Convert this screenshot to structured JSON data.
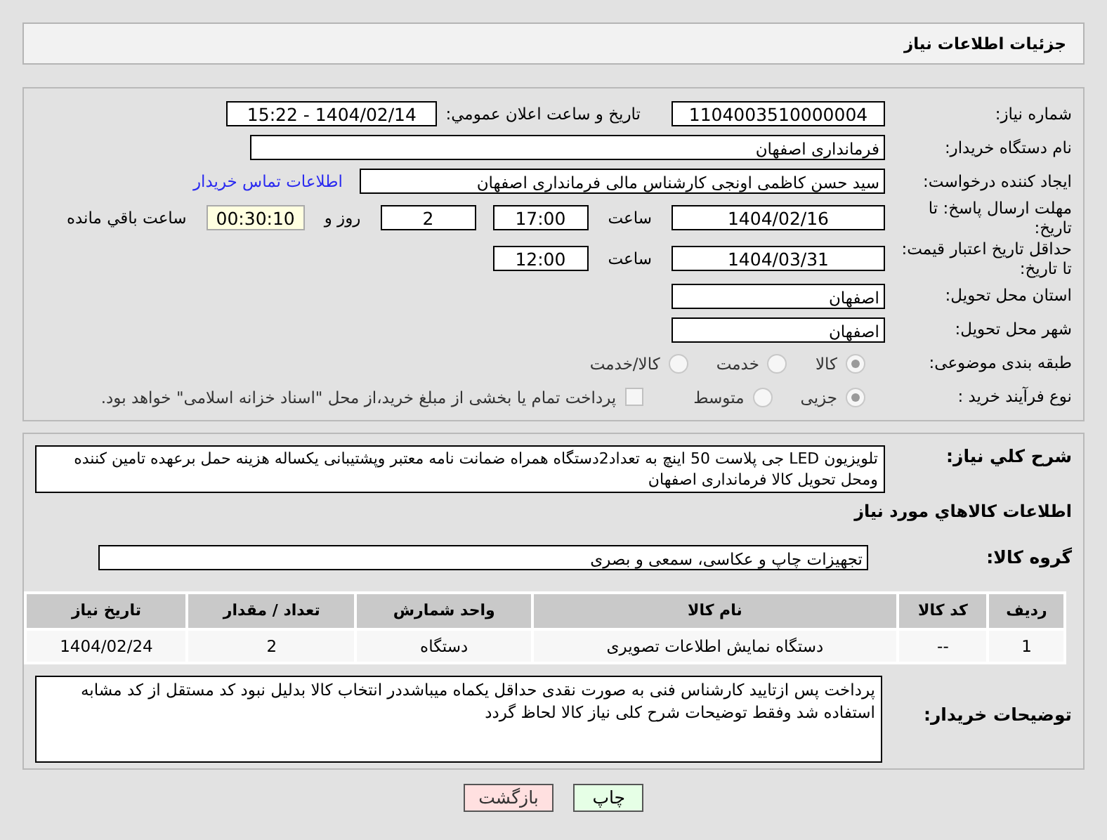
{
  "header": {
    "title": "جزئیات اطلاعات نیاز"
  },
  "need_number": {
    "label": "شماره نیاز:",
    "value": "1104003510000004"
  },
  "announcement": {
    "label": "تاریخ و ساعت اعلان عمومي:",
    "value": "1404/02/14 - 15:22"
  },
  "buyer_org": {
    "label": "نام دستگاه خریدار:",
    "value": "فرمانداری اصفهان"
  },
  "requester": {
    "label": "ایجاد کننده درخواست:",
    "value": "سید حسن  کاظمی اونجی کارشناس مالی  فرمانداری اصفهان",
    "link": "اطلاعات تماس خریدار"
  },
  "response_deadline": {
    "label": "مهلت ارسال پاسخ: تا تاریخ:",
    "date": "1404/02/16",
    "time_label": "ساعت",
    "time": "17:00",
    "days": "2",
    "days_label": "روز و",
    "remaining": "00:30:10",
    "remaining_label": "ساعت باقي مانده"
  },
  "price_validity": {
    "label": "حداقل تاریخ اعتبار قیمت: تا تاریخ:",
    "date": "1404/03/31",
    "time_label": "ساعت",
    "time": "12:00"
  },
  "province": {
    "label": "استان محل تحویل:",
    "value": "اصفهان"
  },
  "city": {
    "label": "شهر محل تحویل:",
    "value": "اصفهان"
  },
  "category": {
    "label": "طبقه بندی موضوعی:",
    "options": [
      {
        "label": "کالا",
        "selected": true
      },
      {
        "label": "خدمت",
        "selected": false
      },
      {
        "label": "کالا/خدمت",
        "selected": false
      }
    ]
  },
  "purchase_process": {
    "label": "نوع فرآیند خرید :",
    "options": [
      {
        "label": "جزیی",
        "selected": true
      },
      {
        "label": "متوسط",
        "selected": false
      }
    ],
    "payment": {
      "label": "پرداخت تمام یا بخشی از مبلغ خرید،از محل \"اسناد خزانه اسلامی\" خواهد بود.",
      "checked": false
    }
  },
  "description": {
    "label": "شرح کلي نیاز:",
    "value": "تلویزیون LED جی پلاست 50  اینچ به تعداد2دستگاه همراه ضمانت نامه معتبر وپشتیبانی یکساله هزینه حمل برعهده تامین کننده ومحل تحویل کالا فرمانداری اصفهان"
  },
  "goods_heading": "اطلاعات کالاهاي مورد نیاز",
  "goods_group": {
    "label": "گروه کالا:",
    "value": "تجهیزات چاپ و عکاسی، سمعی و بصری"
  },
  "table": {
    "columns": [
      "ردیف",
      "کد کالا",
      "نام کالا",
      "واحد شمارش",
      "تعداد / مقدار",
      "تاریخ نیاز"
    ],
    "rows": [
      [
        "1",
        "--",
        "دستگاه نمایش اطلاعات تصویری",
        "دستگاه",
        "2",
        "1404/02/24"
      ]
    ]
  },
  "buyer_notes": {
    "label": "توضیحات خریدار:",
    "value": "پرداخت پس ازتایید کارشناس فنی به صورت نقدی حداقل یکماه میباشددر انتخاب کالا بدلیل نبود کد مستقل از کد مشابه استفاده شد وفقط توضیحات شرح   کلی نیاز کالا لحاظ گردد"
  },
  "buttons": [
    {
      "label": "چاپ",
      "kind": "print"
    },
    {
      "label": "بازگشت",
      "kind": "back"
    }
  ]
}
